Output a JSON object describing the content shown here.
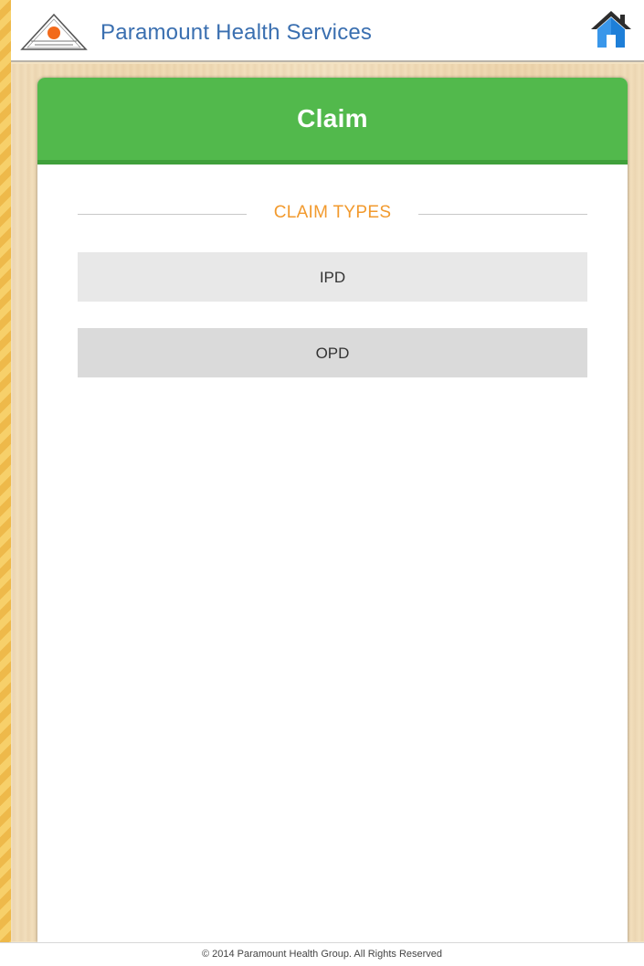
{
  "header": {
    "brand": "Paramount Health Services",
    "home_icon": "home-icon"
  },
  "card": {
    "title": "Claim",
    "section_title": "CLAIM TYPES",
    "buttons": [
      {
        "label": "IPD"
      },
      {
        "label": "OPD"
      }
    ]
  },
  "footer": {
    "text": "© 2014 Paramount Health Group. All Rights Reserved"
  },
  "colors": {
    "header_bar": "#52b94c",
    "brand_text": "#3a6fb0",
    "section_title": "#f29a2e"
  }
}
